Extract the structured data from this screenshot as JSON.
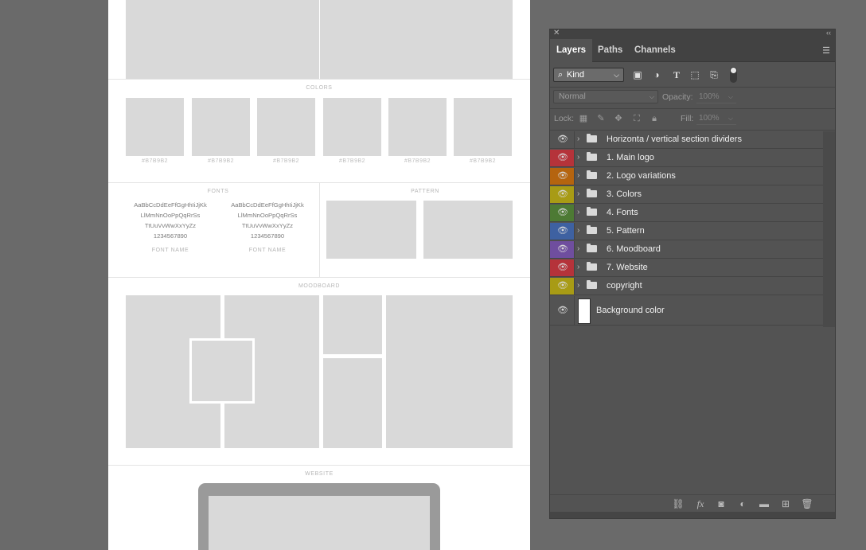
{
  "canvas": {
    "colors": {
      "title": "COLORS",
      "swatches": [
        "#B7B9B2",
        "#B7B9B2",
        "#B7B9B2",
        "#B7B9B2",
        "#B7B9B2",
        "#B7B9B2"
      ]
    },
    "fonts": {
      "title": "FONTS",
      "samples": [
        {
          "lines": [
            "AaBbCcDdEeFfGgHhIiJjKk",
            "LlMmNnOoPpQqRrSs",
            "TtUuVvWwXxYyZz",
            "1234567890"
          ],
          "name": "FONT NAME"
        },
        {
          "lines": [
            "AaBbCcDdEeFfGgHhIiJjKk",
            "LlMmNnOoPpQqRrSs",
            "TtUuVvWwXxYyZz",
            "1234567890"
          ],
          "name": "FONT NAME"
        }
      ]
    },
    "pattern": {
      "title": "PATTERN"
    },
    "moodboard": {
      "title": "MOODBOARD"
    },
    "website": {
      "title": "WEBSITE"
    }
  },
  "panel": {
    "tabs": [
      "Layers",
      "Paths",
      "Channels"
    ],
    "active_tab": "Layers",
    "filter": {
      "label": "Kind"
    },
    "blend_mode": "Normal",
    "opacity_label": "Opacity:",
    "opacity_value": "100%",
    "lock_label": "Lock:",
    "fill_label": "Fill:",
    "fill_value": "100%",
    "layers": [
      {
        "name": "Horizonta / vertical section dividers",
        "color": "#535353",
        "type": "group"
      },
      {
        "name": "1. Main logo",
        "color": "#b5333a",
        "type": "group"
      },
      {
        "name": "2. Logo variations",
        "color": "#b5640f",
        "type": "group"
      },
      {
        "name": "3. Colors",
        "color": "#a89b15",
        "type": "group"
      },
      {
        "name": "4. Fonts",
        "color": "#4d7a34",
        "type": "group"
      },
      {
        "name": "5. Pattern",
        "color": "#3e61a1",
        "type": "group"
      },
      {
        "name": "6. Moodboard",
        "color": "#6f4e9e",
        "type": "group"
      },
      {
        "name": "7. Website",
        "color": "#b5333a",
        "type": "group"
      },
      {
        "name": "copyright",
        "color": "#a89b15",
        "type": "group"
      },
      {
        "name": "Background color",
        "color": "#535353",
        "type": "layer"
      }
    ]
  }
}
